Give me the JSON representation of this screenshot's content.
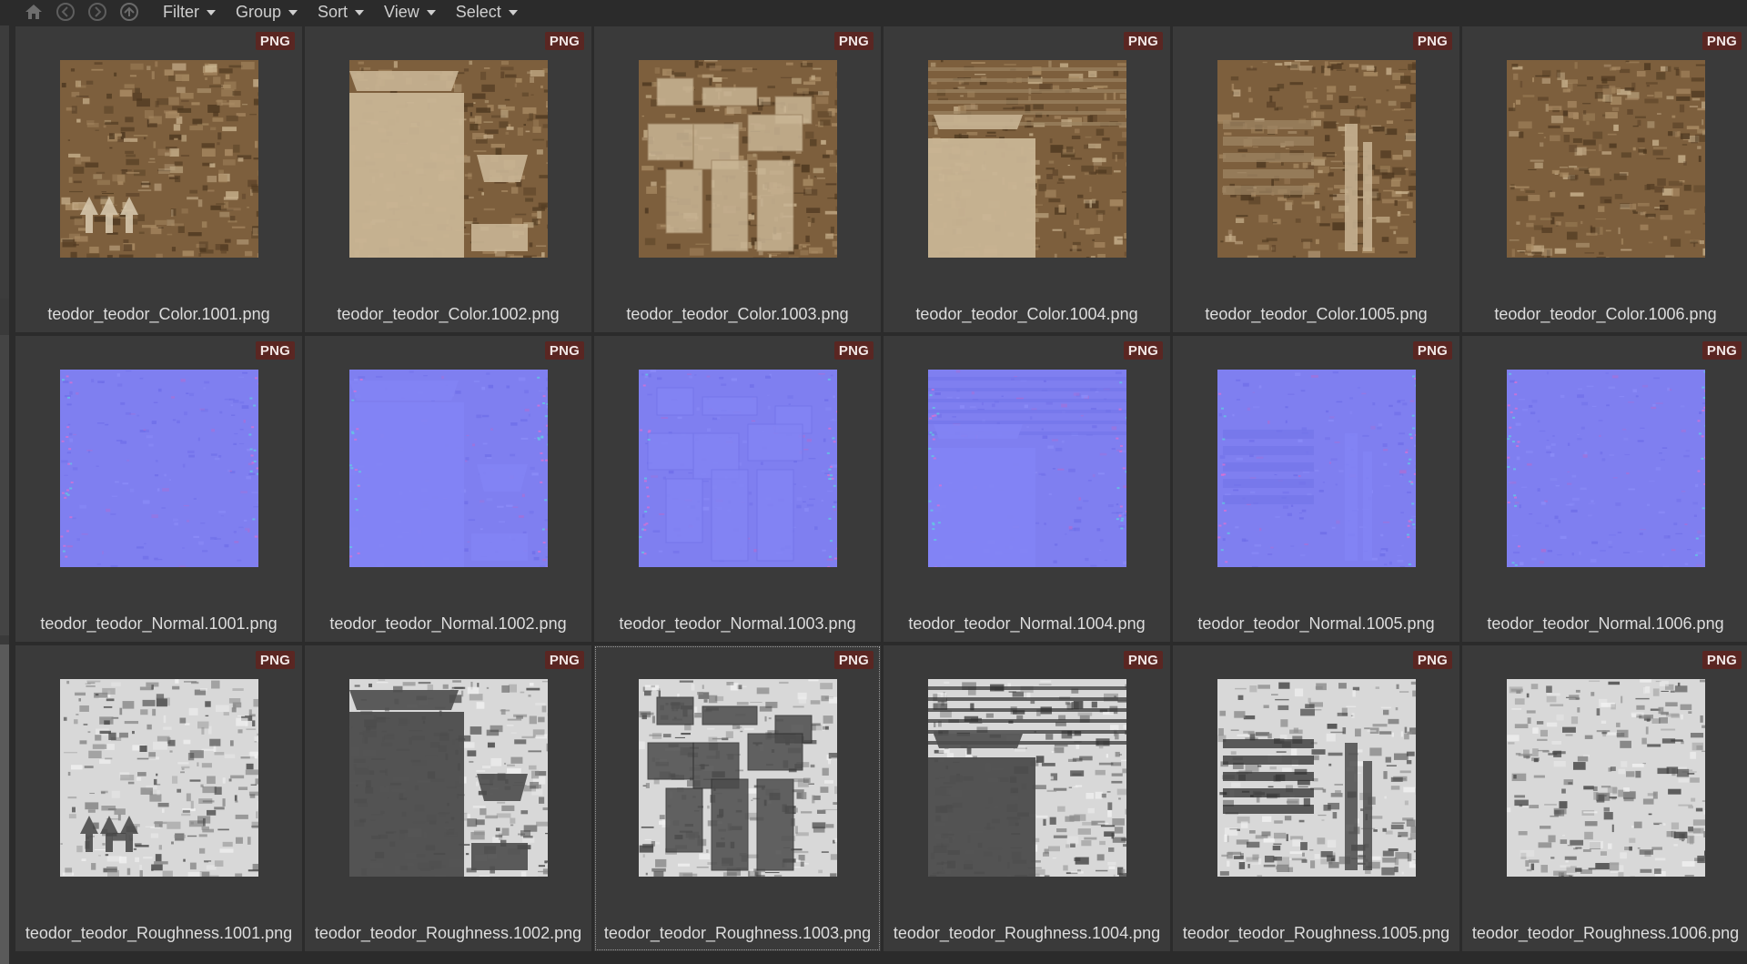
{
  "toolbar": {
    "nav_icons": [
      "home-icon",
      "back-icon",
      "forward-icon",
      "up-icon"
    ],
    "menus": [
      {
        "label": "Filter",
        "name": "filter-menu"
      },
      {
        "label": "Group",
        "name": "group-menu"
      },
      {
        "label": "Sort",
        "name": "sort-menu"
      },
      {
        "label": "View",
        "name": "view-menu"
      },
      {
        "label": "Select",
        "name": "select-menu"
      }
    ]
  },
  "colors": {
    "background": "#2b2b2b",
    "tile": "#3a3a3a",
    "badge": "#5a2622",
    "color_map": "#8b6a45",
    "normal_map": "#7f7ff2",
    "roughness_map": "#bdbdbd"
  },
  "selected_file": "teodor_teodor_Roughness.1003.png",
  "files": [
    {
      "name": "teodor_teodor_Color.1001.png",
      "badge": "PNG",
      "map": "color",
      "variant": 1
    },
    {
      "name": "teodor_teodor_Color.1002.png",
      "badge": "PNG",
      "map": "color",
      "variant": 2
    },
    {
      "name": "teodor_teodor_Color.1003.png",
      "badge": "PNG",
      "map": "color",
      "variant": 3
    },
    {
      "name": "teodor_teodor_Color.1004.png",
      "badge": "PNG",
      "map": "color",
      "variant": 4
    },
    {
      "name": "teodor_teodor_Color.1005.png",
      "badge": "PNG",
      "map": "color",
      "variant": 5
    },
    {
      "name": "teodor_teodor_Color.1006.png",
      "badge": "PNG",
      "map": "color",
      "variant": 6
    },
    {
      "name": "teodor_teodor_Normal.1001.png",
      "badge": "PNG",
      "map": "normal",
      "variant": 1
    },
    {
      "name": "teodor_teodor_Normal.1002.png",
      "badge": "PNG",
      "map": "normal",
      "variant": 2
    },
    {
      "name": "teodor_teodor_Normal.1003.png",
      "badge": "PNG",
      "map": "normal",
      "variant": 3
    },
    {
      "name": "teodor_teodor_Normal.1004.png",
      "badge": "PNG",
      "map": "normal",
      "variant": 4
    },
    {
      "name": "teodor_teodor_Normal.1005.png",
      "badge": "PNG",
      "map": "normal",
      "variant": 5
    },
    {
      "name": "teodor_teodor_Normal.1006.png",
      "badge": "PNG",
      "map": "normal",
      "variant": 6
    },
    {
      "name": "teodor_teodor_Roughness.1001.png",
      "badge": "PNG",
      "map": "roughness",
      "variant": 1
    },
    {
      "name": "teodor_teodor_Roughness.1002.png",
      "badge": "PNG",
      "map": "roughness",
      "variant": 2
    },
    {
      "name": "teodor_teodor_Roughness.1003.png",
      "badge": "PNG",
      "map": "roughness",
      "variant": 3
    },
    {
      "name": "teodor_teodor_Roughness.1004.png",
      "badge": "PNG",
      "map": "roughness",
      "variant": 4
    },
    {
      "name": "teodor_teodor_Roughness.1005.png",
      "badge": "PNG",
      "map": "roughness",
      "variant": 5
    },
    {
      "name": "teodor_teodor_Roughness.1006.png",
      "badge": "PNG",
      "map": "roughness",
      "variant": 6
    }
  ]
}
